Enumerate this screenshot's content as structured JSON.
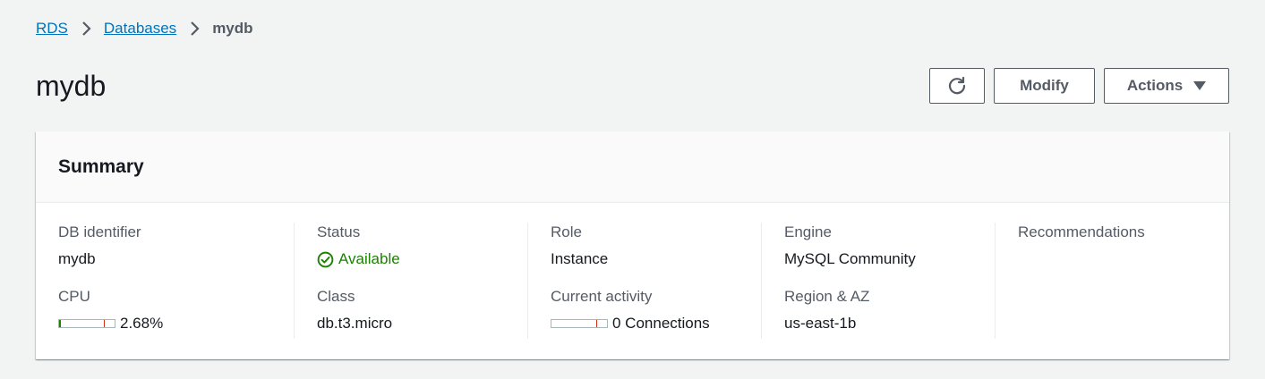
{
  "breadcrumb": {
    "items": [
      {
        "label": "RDS"
      },
      {
        "label": "Databases"
      },
      {
        "label": "mydb"
      }
    ]
  },
  "page": {
    "title": "mydb"
  },
  "toolbar": {
    "refresh_icon": "refresh-icon",
    "modify_label": "Modify",
    "actions_label": "Actions",
    "actions_icon": "caret-down-icon"
  },
  "summary": {
    "title": "Summary",
    "db_identifier": {
      "label": "DB identifier",
      "value": "mydb"
    },
    "cpu": {
      "label": "CPU",
      "value": "2.68%",
      "percent": 2.68
    },
    "status": {
      "label": "Status",
      "value": "Available",
      "icon": "check-circle-icon",
      "color": "#1d8102"
    },
    "class": {
      "label": "Class",
      "value": "db.t3.micro"
    },
    "role": {
      "label": "Role",
      "value": "Instance"
    },
    "current_activity": {
      "label": "Current activity",
      "value": "0 Connections",
      "count": 0
    },
    "engine": {
      "label": "Engine",
      "value": "MySQL Community"
    },
    "region_az": {
      "label": "Region & AZ",
      "value": "us-east-1b"
    },
    "recommendations": {
      "label": "Recommendations"
    }
  },
  "colors": {
    "link": "#0073bb",
    "success": "#1d8102",
    "text_primary": "#16191f",
    "text_secondary": "#545b64",
    "background": "#f2f3f3"
  }
}
